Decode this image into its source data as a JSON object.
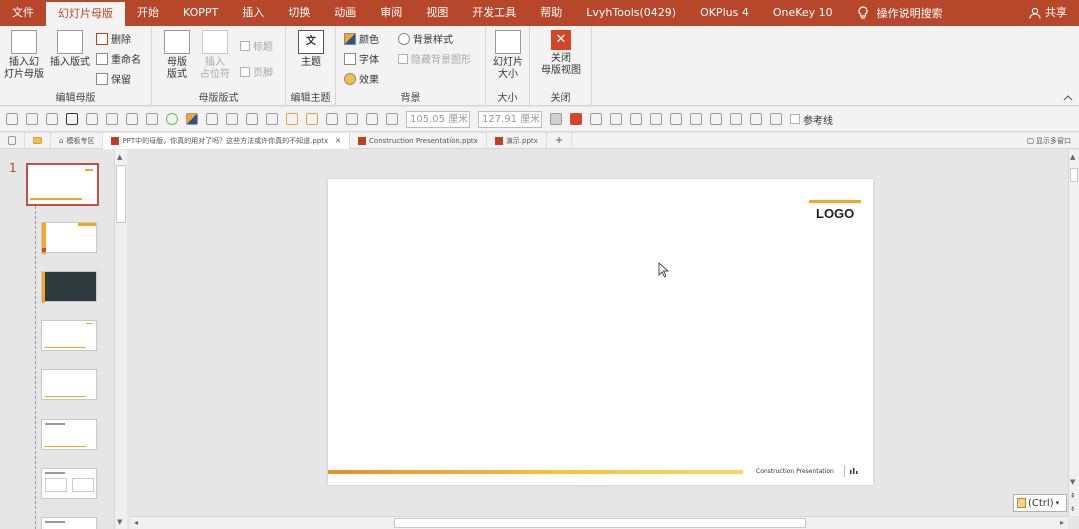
{
  "tabs": [
    "文件",
    "幻灯片母版",
    "开始",
    "KOPPT",
    "插入",
    "切换",
    "动画",
    "审阅",
    "视图",
    "开发工具",
    "帮助",
    "LvyhTools(0429)",
    "OKPlus 4",
    "OneKey 10"
  ],
  "search_label": "操作说明搜索",
  "share_label": "共享",
  "ribbon": {
    "insert_slide_master": "插入幻\n灯片母版",
    "insert_layout": "插入版式",
    "delete": "删除",
    "rename": "重命名",
    "preserve": "保留",
    "group_edit_master": "编辑母版",
    "master_layout": "母版\n版式",
    "insert_placeholder": "插入\n占位符",
    "title": "标题",
    "footer": "页脚",
    "group_master_layout": "母版版式",
    "themes": "主题",
    "group_edit_theme": "编辑主题",
    "colors": "颜色",
    "fonts": "字体",
    "effects": "效果",
    "bg_styles": "背景样式",
    "hide_bg_graphics": "隐藏背景图形",
    "group_background": "背景",
    "slide_size": "幻灯片\n大小",
    "group_size": "大小",
    "close_master_view": "关闭\n母版视图",
    "group_close": "关闭"
  },
  "toolbar2": {
    "width_value": "105.05 厘米",
    "height_value": "127.91 厘米",
    "guides": "参考线"
  },
  "doc_tabs": {
    "templates": "模板专区",
    "file1": "PPT中的母版，你真的用对了吗？这些方法或许你真的不知道.pptx",
    "file2": "Construction Presentation.pptx",
    "file3": "演示.pptx",
    "add": "+",
    "multi_window": "显示多窗口"
  },
  "slide_number": "1",
  "slide": {
    "logo": "LOGO",
    "footer_text": "Construction Presentation"
  },
  "paste_ctrl": "(Ctrl)",
  "colors": {
    "accent": "#b7472a",
    "orange": "#f5a623",
    "dark_slide": "#2e3a3f"
  }
}
